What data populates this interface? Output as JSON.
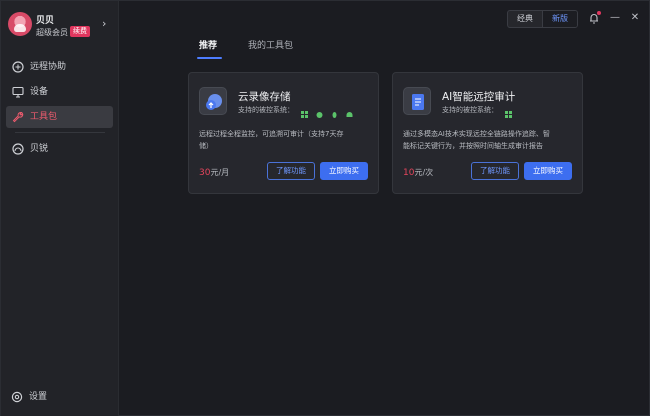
{
  "user": {
    "name": "贝贝",
    "member_label": "超级会员",
    "renew_badge": "续费"
  },
  "sidebar": {
    "items": [
      {
        "label": "远程协助",
        "icon": "remote-assist-icon"
      },
      {
        "label": "设备",
        "icon": "monitor-icon"
      },
      {
        "label": "工具包",
        "icon": "toolbox-icon"
      },
      {
        "label": "贝锐",
        "icon": "oray-logo-icon"
      }
    ],
    "settings_label": "设置"
  },
  "window": {
    "mode_classic": "经典",
    "mode_new": "新版"
  },
  "tabs": [
    {
      "label": "推荐"
    },
    {
      "label": "我的工具包"
    }
  ],
  "colors": {
    "accent": "#3d6ef0",
    "active_nav": "#ef5b6e",
    "price": "#e5455c"
  },
  "cards": [
    {
      "title": "云录像存储",
      "supported_label": "支持的被控系统：",
      "os": [
        "windows-icon",
        "apple-icon",
        "linux-icon",
        "android-icon"
      ],
      "description_lines": [
        "远程过程全程监控，可追溯可审计（支持7天存",
        "储）"
      ],
      "price_number": "30",
      "price_unit": "元/月",
      "learn_label": "了解功能",
      "buy_label": "立即购买"
    },
    {
      "title": "AI智能远控审计",
      "supported_label": "支持的被控系统：",
      "os": [
        "windows-icon"
      ],
      "description_lines": [
        "通过多模态AI技术实现远控全链路操作追踪、智",
        "能标记关键行为，并按照时间轴生成审计报告"
      ],
      "price_number": "10",
      "price_unit": "元/次",
      "learn_label": "了解功能",
      "buy_label": "立即购买"
    }
  ]
}
